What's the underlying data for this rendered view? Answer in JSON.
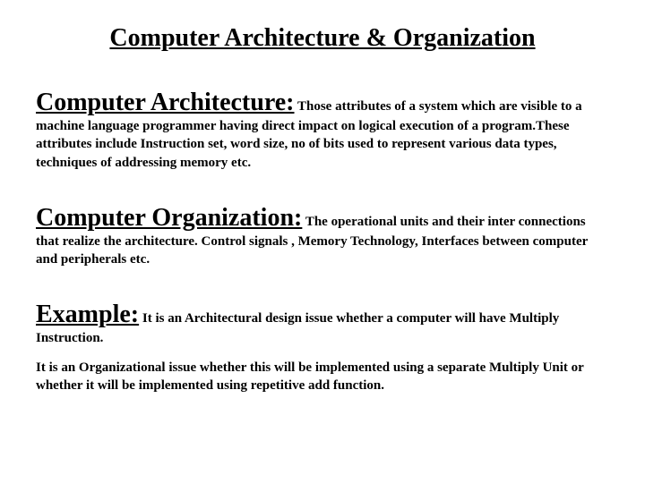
{
  "title": "Computer Architecture & Organization",
  "sections": {
    "architecture": {
      "heading": "Computer Architecture:",
      "body": " Those attributes of a system which are visible to a machine language programmer having direct impact on logical execution of a program.These attributes include Instruction set, word size, no of bits used to represent various data types, techniques of addressing memory etc."
    },
    "organization": {
      "heading": "Computer Organization:",
      "body": " The operational units and their inter connections that realize the architecture. Control signals , Memory Technology, Interfaces between computer and peripherals etc."
    },
    "example": {
      "heading": "Example:",
      "body": " It is an Architectural design issue whether a computer will have Multiply Instruction.",
      "extra": "It is an Organizational issue whether this will be implemented using a separate Multiply Unit or whether it will be implemented using repetitive add function."
    }
  }
}
